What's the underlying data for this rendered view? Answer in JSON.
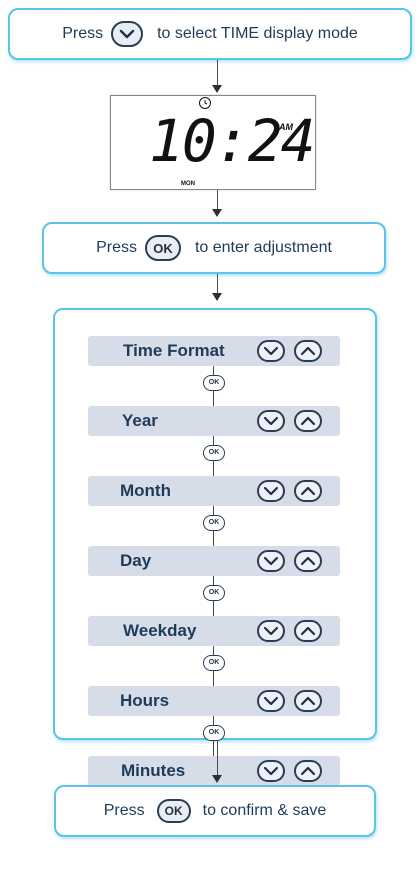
{
  "top_box": {
    "prefix": "Press",
    "suffix": "to select TIME display mode",
    "button_icon": "chevron-down-icon"
  },
  "display": {
    "time": "10:24",
    "ampm": "AM",
    "day": "MON",
    "indicator_icon": "clock-icon"
  },
  "enter_box": {
    "prefix": "Press",
    "suffix": "to enter adjustment",
    "button_label": "OK"
  },
  "steps": [
    {
      "label": "Time Format"
    },
    {
      "label": "Year"
    },
    {
      "label": "Month"
    },
    {
      "label": "Day"
    },
    {
      "label": "Weekday"
    },
    {
      "label": "Hours"
    },
    {
      "label": "Minutes"
    }
  ],
  "step_button_icons": [
    "chevron-down-icon",
    "chevron-up-icon"
  ],
  "connector_button_label": "OK",
  "confirm_box": {
    "prefix": "Press",
    "suffix": "to confirm & save",
    "button_label": "OK"
  },
  "colors": {
    "box_border": "#5cc3e8",
    "step_bar": "#d6dde8",
    "text": "#1f3b5a"
  }
}
